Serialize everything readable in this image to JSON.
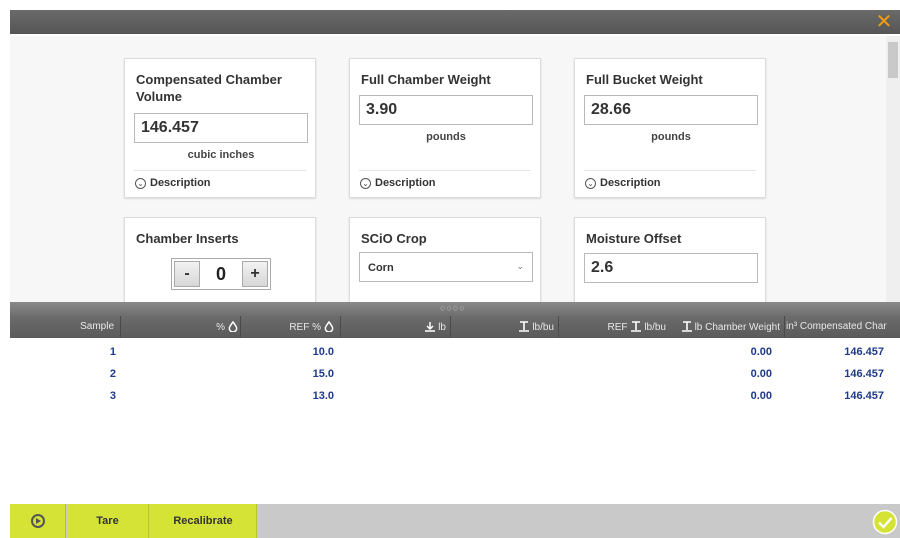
{
  "window": {
    "close_icon": "close-icon",
    "accent_color": "#f39c12"
  },
  "cards": {
    "compensated_volume": {
      "title": "Compensated Chamber Volume",
      "value": "146.457",
      "unit": "cubic inches",
      "description": "Description"
    },
    "full_chamber_weight": {
      "title": "Full Chamber Weight",
      "value": "3.90",
      "unit": "pounds",
      "description": "Description"
    },
    "full_bucket_weight": {
      "title": "Full Bucket Weight",
      "value": "28.66",
      "unit": "pounds",
      "description": "Description"
    },
    "chamber_inserts": {
      "title": "Chamber Inserts",
      "minus_label": "-",
      "value": "0",
      "plus_label": "+"
    },
    "scio_crop": {
      "title": "SCiO Crop",
      "selected": "Corn"
    },
    "moisture_offset": {
      "title": "Moisture Offset",
      "value": "2.6"
    }
  },
  "splitter": {
    "handle": "○○○○"
  },
  "table": {
    "columns": [
      {
        "key": "sample",
        "label": "Sample",
        "icon": ""
      },
      {
        "key": "pct",
        "label": "%",
        "icon": "moisture-drop-icon"
      },
      {
        "key": "ref_pct",
        "label": "REF %",
        "icon": "moisture-drop-icon"
      },
      {
        "key": "lb",
        "label": "lb",
        "icon": "weight-icon"
      },
      {
        "key": "lb_bu",
        "label": "lb/bu",
        "icon": "test-weight-icon"
      },
      {
        "key": "ref_lb_bu",
        "label": "REF",
        "label2": "lb/bu",
        "icon": "test-weight-icon"
      },
      {
        "key": "chamber_weight",
        "label": "lb Chamber Weight",
        "icon": "test-weight-icon"
      },
      {
        "key": "compensated",
        "label": "in³ Compensated Char",
        "icon": ""
      }
    ],
    "rows": [
      {
        "sample": "1",
        "ref_pct": "10.0",
        "chamber_weight": "0.00",
        "compensated": "146.457"
      },
      {
        "sample": "2",
        "ref_pct": "15.0",
        "chamber_weight": "0.00",
        "compensated": "146.457"
      },
      {
        "sample": "3",
        "ref_pct": "13.0",
        "chamber_weight": "0.00",
        "compensated": "146.457"
      }
    ],
    "header_color": "#5f5f5f",
    "value_color": "#1f3a8a"
  },
  "toolbar": {
    "cycle_icon": "cycle-icon",
    "tare_label": "Tare",
    "recalibrate_label": "Recalibrate",
    "ok_icon": "check-circle-icon",
    "button_color": "#d5e336"
  }
}
